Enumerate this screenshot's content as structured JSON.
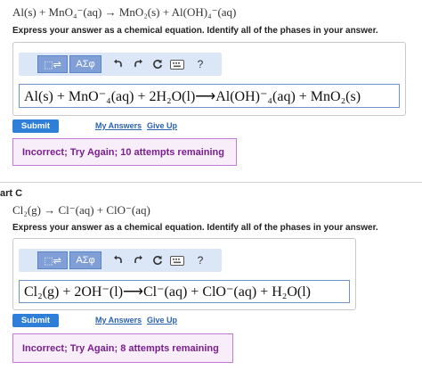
{
  "part_b": {
    "reaction": "Al(s) + MnO₄⁻(aq) → MnO₂(s) + Al(OH)₄⁻(aq)",
    "instruction": "Express your answer as a chemical equation. Identify all of the phases in your answer.",
    "toolbar": {
      "templates_label": "⬚⇌",
      "symbols_label": "ΑΣφ"
    },
    "answer": "Al(s) + MnO⁻₄(aq) + 2H₂O(l)⟶Al(OH)⁻₄(aq) + MnO₂(s)",
    "submit_label": "Submit",
    "my_answers": "My Answers",
    "give_up": "Give Up",
    "feedback": "Incorrect; Try Again; 10 attempts remaining"
  },
  "part_c": {
    "title": "art C",
    "reaction": "Cl₂(g) → Cl⁻(aq) + ClO⁻(aq)",
    "instruction": "Express your answer as a chemical equation. Identify all of the phases in your answer.",
    "toolbar": {
      "templates_label": "⬚⇌",
      "symbols_label": "ΑΣφ"
    },
    "answer": "Cl₂(g) + 2OH⁻(l)⟶Cl⁻(aq) + ClO⁻(aq) + H₂O(l)",
    "submit_label": "Submit",
    "my_answers": "My Answers",
    "give_up": "Give Up",
    "feedback": "Incorrect; Try Again; 8 attempts remaining"
  },
  "icons": {
    "undo": "undo-icon",
    "redo": "redo-icon",
    "reset": "reset-icon",
    "keyboard": "keyboard-icon",
    "help": "help-icon"
  },
  "colors": {
    "accent": "#2f7ed8",
    "toolbar_bg": "#dbe7f6",
    "feedback_border": "#c37ad6",
    "feedback_text": "#7a1f8e"
  }
}
